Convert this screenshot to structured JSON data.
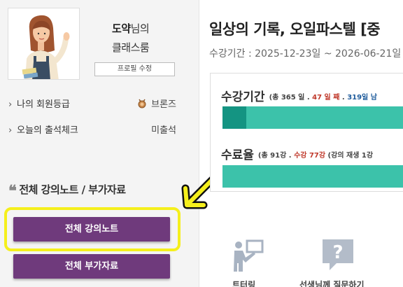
{
  "profile": {
    "name_bold": "도약",
    "name_suffix": "님의",
    "subtitle": "클래스룸",
    "edit_button": "프로필 수정"
  },
  "info": {
    "grade_label": "나의 회원등급",
    "grade_value": "브론즈",
    "attendance_label": "오늘의 출석체크",
    "attendance_value": "미출석"
  },
  "section": {
    "title": "전체 강의노트 / 부가자료",
    "btn_notes": "전체 강의노트",
    "btn_materials": "전체 부가자료"
  },
  "course": {
    "title": "일상의 기록, 오일파스텔 [중",
    "period": "수강기간 : 2025-12-23일 ~ 2026-06-21일"
  },
  "progress": {
    "period_label": "수강기간",
    "period_detail_a": "(총 365 일 . ",
    "period_detail_b": "47 일 째",
    "period_detail_c": " . ",
    "period_detail_d": "319일 남",
    "period_fill": 0.13,
    "completion_label": "수료율",
    "completion_detail_a": "(총 91강 . ",
    "completion_detail_b": "수강 77강",
    "completion_detail_c": " (강의 재생 1강",
    "completion_fill": 0.0
  },
  "icons": {
    "left_label": "트터링",
    "right_label": "선생님께 질문하기"
  },
  "colors": {
    "purple": "#6f3a7c",
    "teal_dark": "#149482",
    "teal_light": "#3cc2aa",
    "highlight": "#f5ef1c"
  }
}
